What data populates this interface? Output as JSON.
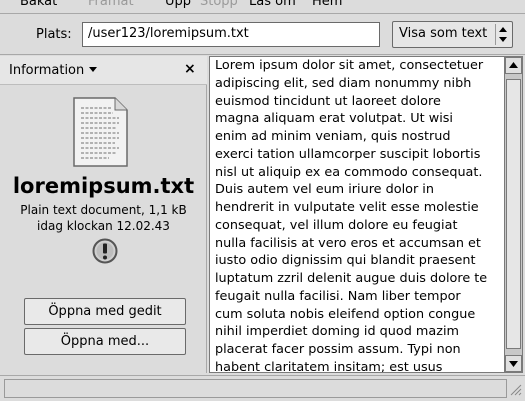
{
  "toolbar": {
    "back": "Bakåt",
    "forward": "Framåt",
    "up": "Upp",
    "stop": "Stopp",
    "reload": "Läs om",
    "home": "Hem"
  },
  "location": {
    "label": "Plats:",
    "value": "/user123/loremipsum.txt",
    "view_mode": "Visa som text"
  },
  "sidebar": {
    "title": "Information",
    "file_name": "loremipsum.txt",
    "file_type": "Plain text document, 1,1 kB",
    "modified": "idag klockan 12.02.43",
    "buttons": [
      "Öppna med gedit",
      "Öppna med..."
    ]
  },
  "text_content": "Lorem ipsum dolor sit amet, consectetuer\nadipiscing elit, sed diam nonummy nibh\neuismod tincidunt ut laoreet dolore\nmagna aliquam erat volutpat. Ut wisi\nenim ad minim veniam, quis nostrud\nexerci tation ullamcorper suscipit lobortis\nnisl ut aliquip ex ea commodo consequat.\nDuis autem vel eum iriure dolor in\nhendrerit in vulputate velit esse molestie\nconsequat, vel illum dolore eu feugiat\nnulla facilisis at vero eros et accumsan et\niusto odio dignissim qui blandit praesent\nluptatum zzril delenit augue duis dolore te\nfeugait nulla facilisi. Nam liber tempor\ncum soluta nobis eleifend option congue\nnihil imperdiet doming id quod mazim\nplacerat facer possim assum. Typi non\nhabent claritatem insitam; est usus\nlegentis in iis qui facit eorum claritatem.",
  "icons": {
    "file": "text-file-icon",
    "warning": "warning-icon",
    "close": "close-icon",
    "dropdown": "chevron-down-icon"
  }
}
